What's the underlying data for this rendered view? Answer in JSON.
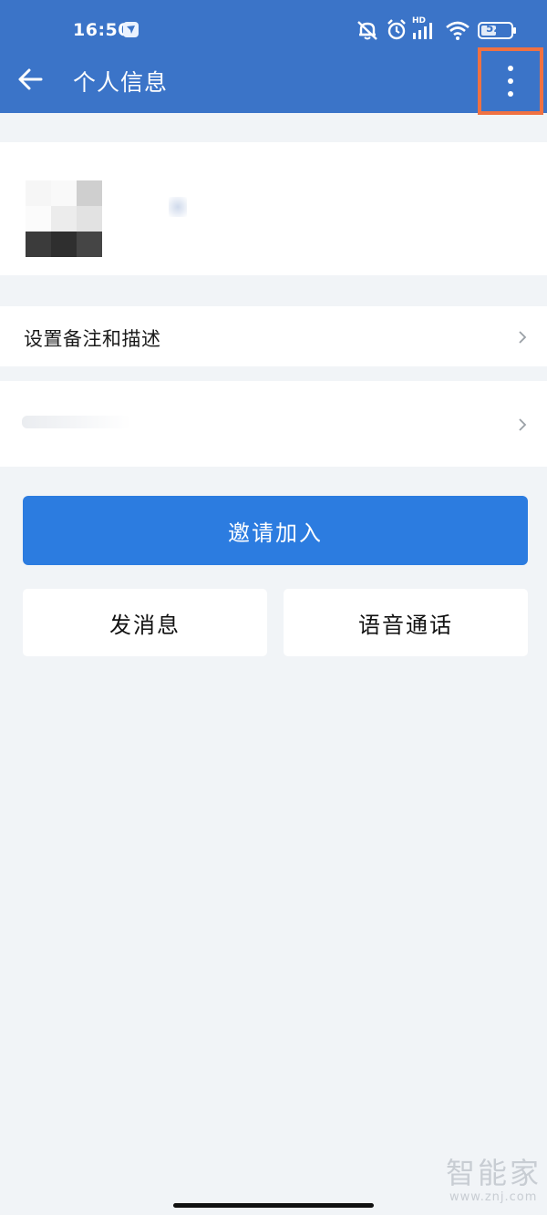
{
  "status_bar": {
    "time": "16:50",
    "battery": "52",
    "network_label": "HD",
    "icons": [
      "app-notification-icon",
      "mute-icon",
      "alarm-icon",
      "cellular-signal-icon",
      "wifi-icon",
      "battery-icon"
    ]
  },
  "header": {
    "title": "个人信息",
    "back_icon": "arrow-left-icon",
    "more_icon": "more-vertical-icon"
  },
  "rows": {
    "remark_label": "设置备注和描述"
  },
  "actions": {
    "invite_label": "邀请加入",
    "message_label": "发消息",
    "voice_call_label": "语音通话"
  },
  "watermark": {
    "text": "智能家",
    "url": "www.znj.com"
  },
  "colors": {
    "header_bg": "#3b74c8",
    "primary_button": "#2c7ce0",
    "highlight_border": "#f07142",
    "page_bg": "#f1f4f7"
  }
}
